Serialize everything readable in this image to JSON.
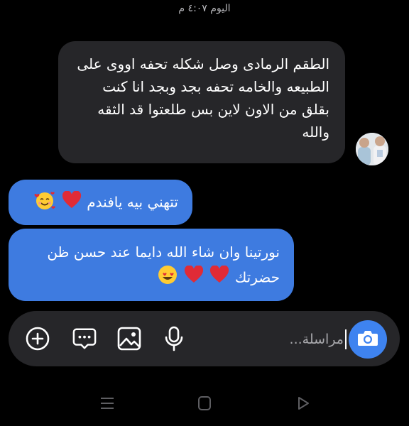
{
  "header": {
    "timestamp": "اليوم ٤:٠٧ م"
  },
  "messages": [
    {
      "direction": "received",
      "text": "الطقم الرمادى وصل شكله تحفه اووى على الطبيعه والخامه تحفه بجد وبجد انا كنت بقلق من الاون لاين بس طلعتوا قد الثقه والله"
    },
    {
      "direction": "sent",
      "text": "تتهني بيه يافندم",
      "emojis": [
        "red-heart",
        "smiling-face-with-hearts"
      ]
    },
    {
      "direction": "sent",
      "text": "نورتينا وان شاء الله دايما عند حسن ظن حضرتك",
      "emojis": [
        "red-heart",
        "red-heart",
        "smiling-face-with-heart-eyes"
      ]
    }
  ],
  "composer": {
    "placeholder": "مراسلة...",
    "icons": [
      "plus-circle-icon",
      "chat-bubble-dots-icon",
      "gallery-icon",
      "microphone-icon",
      "camera-icon"
    ]
  },
  "colors": {
    "background": "#000000",
    "received_bubble": "#262629",
    "sent_bubble": "#3e7be0",
    "camera_button": "#3e83f0"
  },
  "navbar": {
    "icons": [
      "menu-icon",
      "home-icon",
      "back-icon"
    ]
  }
}
